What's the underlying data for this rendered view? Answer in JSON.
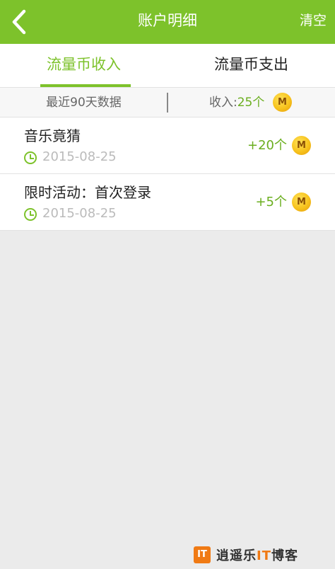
{
  "header": {
    "title": "账户明细",
    "clear_label": "清空",
    "back_icon": "chevron-left-icon"
  },
  "tabs": [
    {
      "label": "流量币收入",
      "active": true
    },
    {
      "label": "流量币支出",
      "active": false
    }
  ],
  "summary": {
    "period_label": "最近90天数据",
    "income_prefix": "收入:",
    "income_value": "25个",
    "coin_label": "M"
  },
  "records": [
    {
      "name": "音乐竟猜",
      "date": "2015-08-25",
      "amount": "+20个",
      "coin_label": "M"
    },
    {
      "name": "限时活动：首次登录",
      "date": "2015-08-25",
      "amount": "+5个",
      "coin_label": "M"
    }
  ],
  "watermark": {
    "logo_text": "IT",
    "text_before": "逍遥乐",
    "text_accent": "IT",
    "text_after": "博客"
  },
  "colors": {
    "accent": "#7dc22b",
    "amount_green": "#6aae1e",
    "coin_gold": "#f7c21c"
  }
}
